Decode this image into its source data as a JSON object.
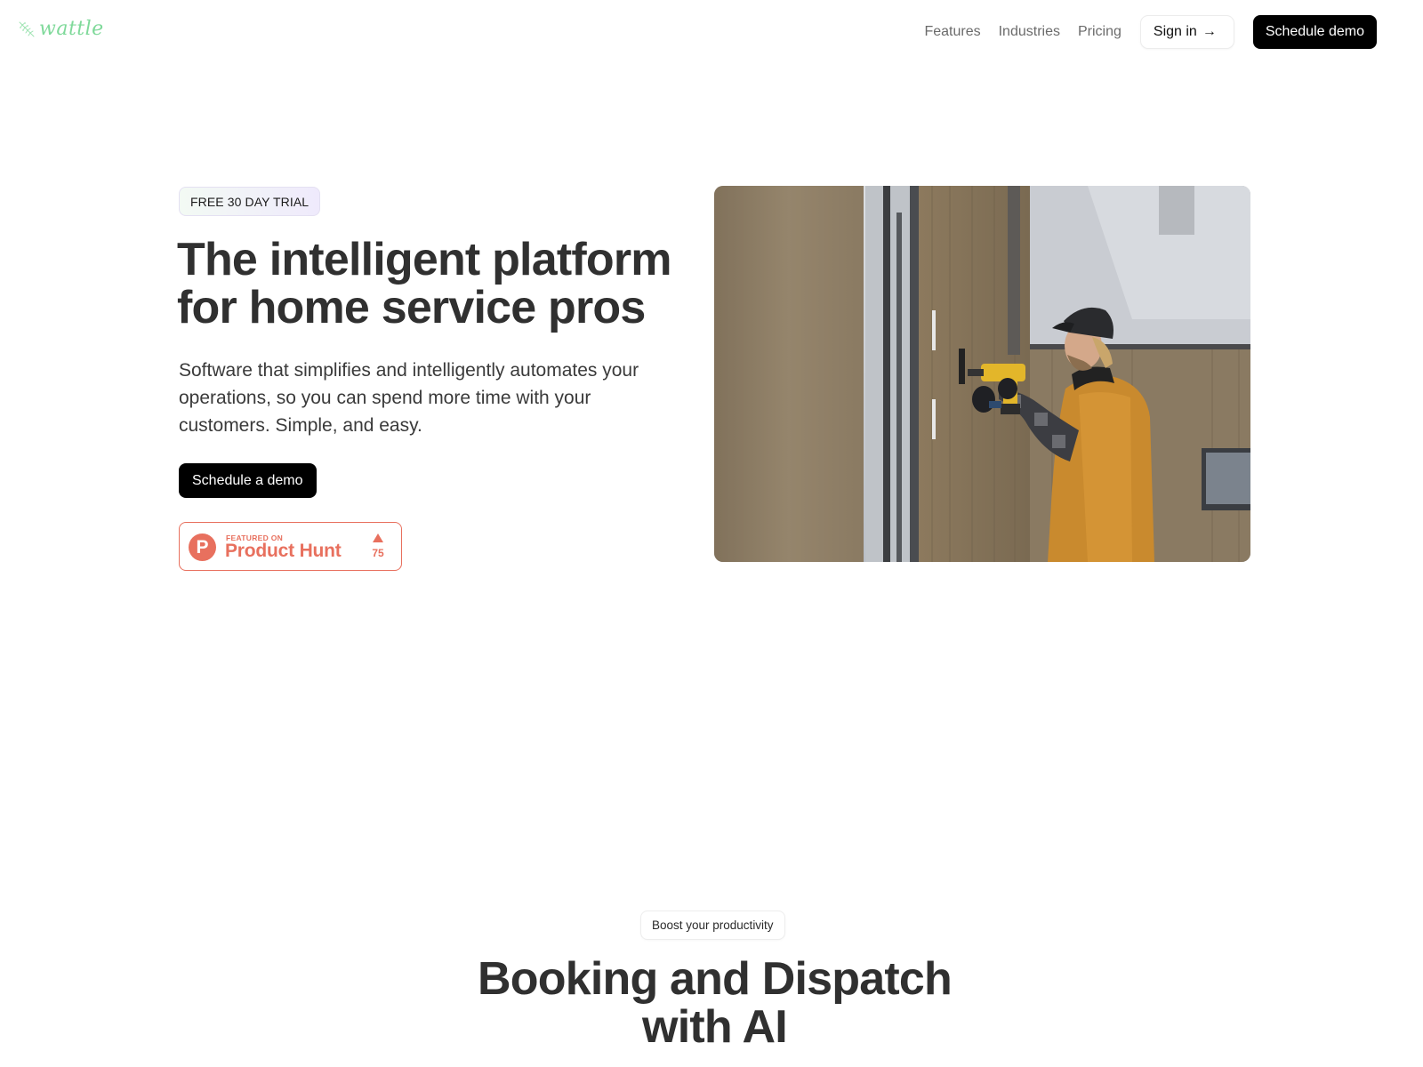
{
  "header": {
    "logo_text": "wattle",
    "nav": [
      {
        "label": "Features"
      },
      {
        "label": "Industries"
      },
      {
        "label": "Pricing"
      }
    ],
    "sign_in_label": "Sign in",
    "sign_in_icon": "arrow-right-icon",
    "schedule_demo_label": "Schedule demo"
  },
  "hero": {
    "badge": "FREE 30 DAY TRIAL",
    "title_line1": "The intelligent platform",
    "title_line2": "for home service pros",
    "subtitle": "Software that simplifies and intelligently automates your operations, so you can spend more time with your customers. Simple, and easy.",
    "cta_label": "Schedule a demo",
    "product_hunt": {
      "featured_label": "FEATURED ON",
      "name": "Product Hunt",
      "logo_letter": "P",
      "upvotes": "75",
      "color": "#e8705e"
    },
    "image_alt": "Tradesman in orange vest drilling into wooden wall"
  },
  "section": {
    "badge": "Boost your productivity",
    "title_line1": "Booking and Dispatch",
    "title_line2": "with AI"
  },
  "colors": {
    "brand_green": "#7fd99a",
    "cta_black": "#000000",
    "product_hunt": "#e8705e",
    "heading_text": "#303030"
  }
}
